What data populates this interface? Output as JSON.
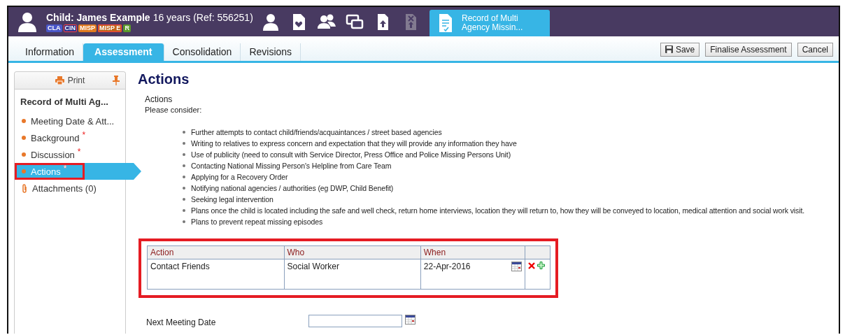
{
  "header": {
    "title": "Child: James Example",
    "subtitle": "16 years (Ref: 556251)",
    "badges": [
      {
        "label": "CLA",
        "color": "#4a56c8",
        "struck": false
      },
      {
        "label": "CIN",
        "color": "#2a2f8a",
        "struck": true
      },
      {
        "label": "MISP",
        "color": "#e07a1f",
        "struck": false
      },
      {
        "label": "MISP E",
        "color": "#c0651a",
        "struck": true
      },
      {
        "label": "R",
        "color": "#5a9a2a",
        "struck": false
      }
    ],
    "tools": [
      {
        "kind": "person",
        "disabled": false
      },
      {
        "kind": "doc-heart",
        "disabled": false
      },
      {
        "kind": "group",
        "disabled": false
      },
      {
        "kind": "windows",
        "disabled": false
      },
      {
        "kind": "doc-upload",
        "disabled": false
      },
      {
        "kind": "doc-x",
        "disabled": true
      }
    ],
    "open_document": {
      "title": "Record of Multi Agency Missin...",
      "selected": true
    }
  },
  "tabs": [
    {
      "label": "Information",
      "selected": false
    },
    {
      "label": "Assessment",
      "selected": true
    },
    {
      "label": "Consolidation",
      "selected": false
    },
    {
      "label": "Revisions",
      "selected": false
    }
  ],
  "buttons": [
    {
      "label": "Save",
      "kind": "save"
    },
    {
      "label": "Finalise Assessment",
      "kind": "plain"
    },
    {
      "label": "Cancel",
      "kind": "plain"
    }
  ],
  "sidebar": {
    "print": "Print",
    "title": "Record of Multi Ag...",
    "items": [
      {
        "label": "Meeting Date & Att...",
        "kind": "section",
        "required": false,
        "selected": false,
        "highlighted": false
      },
      {
        "label": "Background",
        "kind": "section",
        "required": true,
        "selected": false,
        "highlighted": false
      },
      {
        "label": "Discussion",
        "kind": "section",
        "required": true,
        "selected": false,
        "highlighted": false
      },
      {
        "label": "Actions",
        "kind": "section",
        "required": true,
        "selected": true,
        "highlighted": true
      },
      {
        "label": "Attachments (0)",
        "kind": "attachments",
        "required": false,
        "selected": false,
        "highlighted": false
      }
    ],
    "required_mark": "*"
  },
  "main": {
    "heading": "Actions",
    "label": "Actions",
    "intro": "Please consider:",
    "bullets": [
      "Further attempts to contact child/friends/acquaintances / street based agencies",
      "Writing to relatives to express concern and expectation that they will provide any information they have",
      "Use of publicity (need to consult with Service Director, Press Office and Police Missing Persons Unit)",
      "Contacting National Missing Person's Helpline from Care Team",
      "Applying for a Recovery Order",
      "Notifying national agencies / authorities (eg DWP, Child Benefit)",
      "Seeking legal intervention",
      "Plans once the child is located including the safe and well check, return home interviews, location they will return to, how they will be conveyed to location, medical attention and social work visit.",
      "Plans to prevent repeat missing episodes"
    ],
    "table": {
      "highlighted": true,
      "columns": [
        "Action",
        "Who",
        "When"
      ],
      "rows": [
        {
          "action": "Contact Friends",
          "who": "Social Worker",
          "when": "22-Apr-2016"
        }
      ]
    },
    "next_meeting": {
      "label": "Next Meeting Date"
    }
  }
}
